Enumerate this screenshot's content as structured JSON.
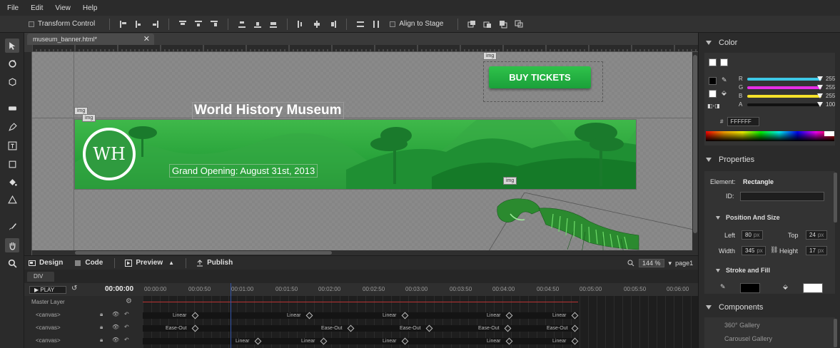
{
  "menu": [
    "File",
    "Edit",
    "View",
    "Help"
  ],
  "toolbar": {
    "transform_control": "Transform Control",
    "align_to_stage": "Align to Stage"
  },
  "document": {
    "tab_title": "museum_banner.html*",
    "close": "✕",
    "stage": {
      "title": "World History Museum",
      "logo_text": "WH",
      "grand_opening": "Grand Opening: August 31st, 2013",
      "buy_button": "BUY TICKETS",
      "img_tag": "img"
    }
  },
  "modebar": {
    "design": "Design",
    "code": "Code",
    "preview": "Preview",
    "publish": "Publish",
    "zoom": "144 %",
    "page": "page1"
  },
  "timeline": {
    "tab": "DIV",
    "play": "PLAY",
    "timecode": "00:00:00",
    "marks": [
      "00:00:00",
      "00:00:50",
      "00:01:00",
      "00:01:50",
      "00:02:00",
      "00:02:50",
      "00:03:00",
      "00:03:50",
      "00:04:00",
      "00:04:50",
      "00:05:00",
      "00:05:50",
      "00:06:00"
    ],
    "master_layer": "Master Layer",
    "rows": [
      "<canvas>",
      "<canvas>",
      "<canvas>"
    ],
    "row1_labels": [
      "Linear",
      "Linear",
      "Linear",
      "Linear",
      "Linear"
    ],
    "row2_labels": [
      "Ease-Out",
      "Ease-Out",
      "Ease-Out",
      "Ease-Out",
      "Ease-Out"
    ],
    "row3_labels": [
      "Linear",
      "Linear",
      "Linear",
      "Linear",
      "Linear"
    ]
  },
  "color_panel": {
    "title": "Color",
    "r_label": "R",
    "g_label": "G",
    "b_label": "B",
    "a_label": "A",
    "r": "255",
    "g": "255",
    "b": "255",
    "a": "100",
    "hex_label": "#",
    "hex": "FFFFFF",
    "accent_r": "#3ec8e6",
    "accent_g": "#e62ee6",
    "accent_b": "#f5e12a"
  },
  "properties": {
    "title": "Properties",
    "element_label": "Element:",
    "element_value": "Rectangle",
    "id_label": "ID:",
    "position_size": "Position And Size",
    "left_label": "Left",
    "left_value": "80",
    "top_label": "Top",
    "top_value": "24",
    "width_label": "Width",
    "width_value": "345",
    "height_label": "Height",
    "height_value": "17",
    "unit": "px",
    "stroke_fill": "Stroke and Fill"
  },
  "components": {
    "title": "Components",
    "items": [
      "360° Gallery",
      "Carousel Gallery"
    ]
  }
}
